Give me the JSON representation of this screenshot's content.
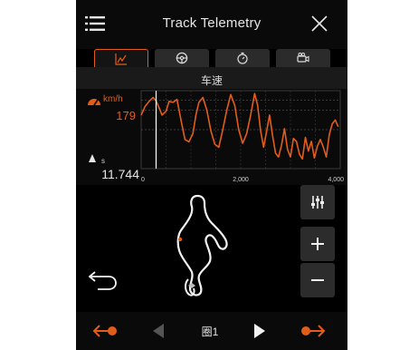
{
  "header": {
    "title": "Track Telemetry",
    "menu_icon": "hamburger-menu-icon",
    "close_icon": "close-icon"
  },
  "tabs": [
    {
      "icon": "line-chart-icon",
      "active": true
    },
    {
      "icon": "steering-wheel-icon",
      "active": false
    },
    {
      "icon": "stopwatch-icon",
      "active": false
    },
    {
      "icon": "video-camera-icon",
      "active": false
    }
  ],
  "chart": {
    "title": "车速",
    "speed_unit": "km/h",
    "speed_value": "179",
    "time_unit": "s",
    "time_value": "11.744",
    "cursor_distance": 300,
    "x_ticks": [
      "0",
      "2,000",
      "4,000"
    ],
    "colors": {
      "series": "#e35d1a",
      "grid": "#6a6a6a",
      "cursor": "#ffffff"
    }
  },
  "chart_data": {
    "type": "line",
    "xlabel": "",
    "ylabel": "km/h",
    "xlim": [
      0,
      4000
    ],
    "ylim": [
      40,
      200
    ],
    "series": [
      {
        "x": [
          0,
          80,
          160,
          240,
          300,
          360,
          420,
          500,
          560,
          640,
          720,
          800,
          880,
          960,
          1040,
          1100,
          1160,
          1240,
          1320,
          1400,
          1480,
          1560,
          1640,
          1720,
          1800,
          1880,
          1960,
          2040,
          2120,
          2200,
          2280,
          2340,
          2400,
          2460,
          2520,
          2580,
          2640,
          2700,
          2760,
          2820,
          2880,
          2940,
          3000,
          3060,
          3120,
          3180,
          3240,
          3300,
          3360,
          3420,
          3480,
          3540,
          3600,
          3660,
          3720,
          3780,
          3840,
          3900,
          3960
        ],
        "values": [
          150,
          168,
          178,
          186,
          179,
          165,
          150,
          158,
          178,
          176,
          182,
          140,
          100,
          95,
          112,
          150,
          176,
          186,
          160,
          118,
          90,
          84,
          120,
          160,
          192,
          170,
          120,
          92,
          112,
          150,
          194,
          170,
          118,
          84,
          116,
          150,
          108,
          72,
          64,
          88,
          122,
          80,
          64,
          102,
          96,
          70,
          60,
          104,
          76,
          96,
          62,
          86,
          100,
          84,
          64,
          110,
          132,
          140,
          126
        ]
      }
    ]
  },
  "map": {
    "track_icon": "track-outline",
    "back_icon": "back-arrow-icon",
    "buttons": [
      {
        "icon": "sliders-icon"
      },
      {
        "icon": "plus-icon"
      },
      {
        "icon": "minus-icon"
      }
    ]
  },
  "footer": {
    "lap_label": "圈1",
    "prev_lap_icon": "prev-lap-icon",
    "prev_icon": "play-left-icon",
    "next_icon": "play-right-icon",
    "next_lap_icon": "next-lap-icon"
  }
}
